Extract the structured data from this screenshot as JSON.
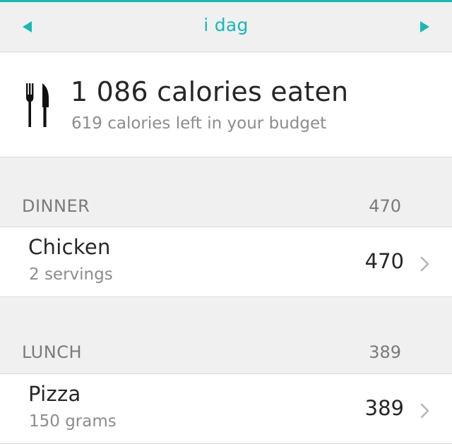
{
  "header": {
    "title": "i dag",
    "prev_icon": "triangle-left-icon",
    "next_icon": "triangle-right-icon",
    "accent_color": "#17b8b5"
  },
  "summary": {
    "icon": "fork-knife-icon",
    "calories_eaten": "1 086 calories eaten",
    "calories_left": "619 calories left in your budget"
  },
  "meals": [
    {
      "section": "DINNER",
      "section_total": "470",
      "items": [
        {
          "name": "Chicken",
          "amount": "2 servings",
          "calories": "470"
        }
      ]
    },
    {
      "section": "LUNCH",
      "section_total": "389",
      "items": [
        {
          "name": "Pizza",
          "amount": "150 grams",
          "calories": "389"
        }
      ]
    }
  ]
}
